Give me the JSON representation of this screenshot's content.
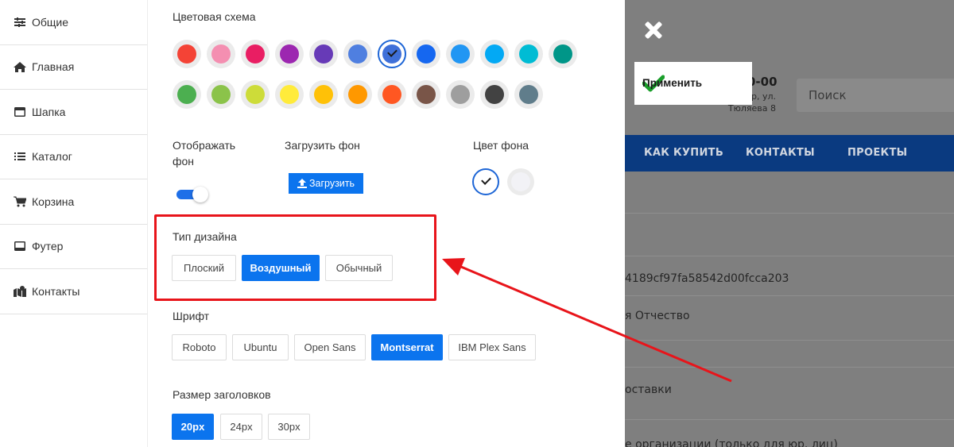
{
  "background_page": {
    "phone_fragment": "0-00",
    "address_line1": "р, ул.",
    "address_line2": "Тюляева 8",
    "search_placeholder": "Поиск",
    "nav": [
      "КАК КУПИТЬ",
      "КОНТАКТЫ",
      "ПРОЕКТЫ"
    ],
    "rows": [
      "4189cf97fa58542d00fcca203",
      "я Отчество",
      "оставки",
      "е организации (только для юр. лиц)"
    ],
    "nav_color": "#0a3a80"
  },
  "apply_button": {
    "label": "Применить",
    "icon": "check-icon",
    "icon_color": "#1a9e2a"
  },
  "close_button": {
    "icon": "close-icon"
  },
  "sidebar": {
    "items": [
      {
        "label": "Общие",
        "icon": "sliders-icon",
        "glyph": "☰"
      },
      {
        "label": "Главная",
        "icon": "home-icon",
        "glyph": "⌂"
      },
      {
        "label": "Шапка",
        "icon": "header-icon",
        "glyph": "▬"
      },
      {
        "label": "Каталог",
        "icon": "list-icon",
        "glyph": "☷"
      },
      {
        "label": "Корзина",
        "icon": "cart-icon",
        "glyph": "🛒"
      },
      {
        "label": "Футер",
        "icon": "footer-icon",
        "glyph": "▬"
      },
      {
        "label": "Контакты",
        "icon": "map-icon",
        "glyph": "⚲"
      }
    ]
  },
  "panel": {
    "color_scheme_label": "Цветовая схема",
    "colors_row1": [
      "#f44336",
      "#f48fb1",
      "#e91e63",
      "#9c27b0",
      "#673ab7",
      "#4f7fe0",
      "#3f70d9",
      "#1567f0",
      "#2196f3",
      "#03a9f4",
      "#00bcd4",
      "#009688"
    ],
    "colors_row2": [
      "#4caf50",
      "#8bc34a",
      "#cddc39",
      "#ffeb3b",
      "#ffc107",
      "#ff9800",
      "#ff5722",
      "#795548",
      "#9e9e9e",
      "#424242",
      "#607d8b"
    ],
    "selected_color_index": 6,
    "show_bg_label_line1": "Отображать",
    "show_bg_label_line2": "фон",
    "show_bg_enabled": true,
    "upload_bg_label": "Загрузить фон",
    "upload_button": "Загрузить",
    "bg_color_label": "Цвет фона",
    "design_type_label": "Тип дизайна",
    "design_types": [
      {
        "label": "Плоский",
        "active": false
      },
      {
        "label": "Воздушный",
        "active": true
      },
      {
        "label": "Обычный",
        "active": false
      }
    ],
    "font_label": "Шрифт",
    "fonts": [
      {
        "label": "Roboto",
        "active": false
      },
      {
        "label": "Ubuntu",
        "active": false
      },
      {
        "label": "Open Sans",
        "active": false
      },
      {
        "label": "Montserrat",
        "active": true
      },
      {
        "label": "IBM Plex Sans",
        "active": false
      }
    ],
    "heading_size_label": "Размер заголовков",
    "heading_sizes": [
      {
        "label": "20px",
        "active": true
      },
      {
        "label": "24px",
        "active": false
      },
      {
        "label": "30px",
        "active": false
      }
    ],
    "accent_color": "#0b74ee"
  },
  "annotation": {
    "color": "#e8141a"
  }
}
